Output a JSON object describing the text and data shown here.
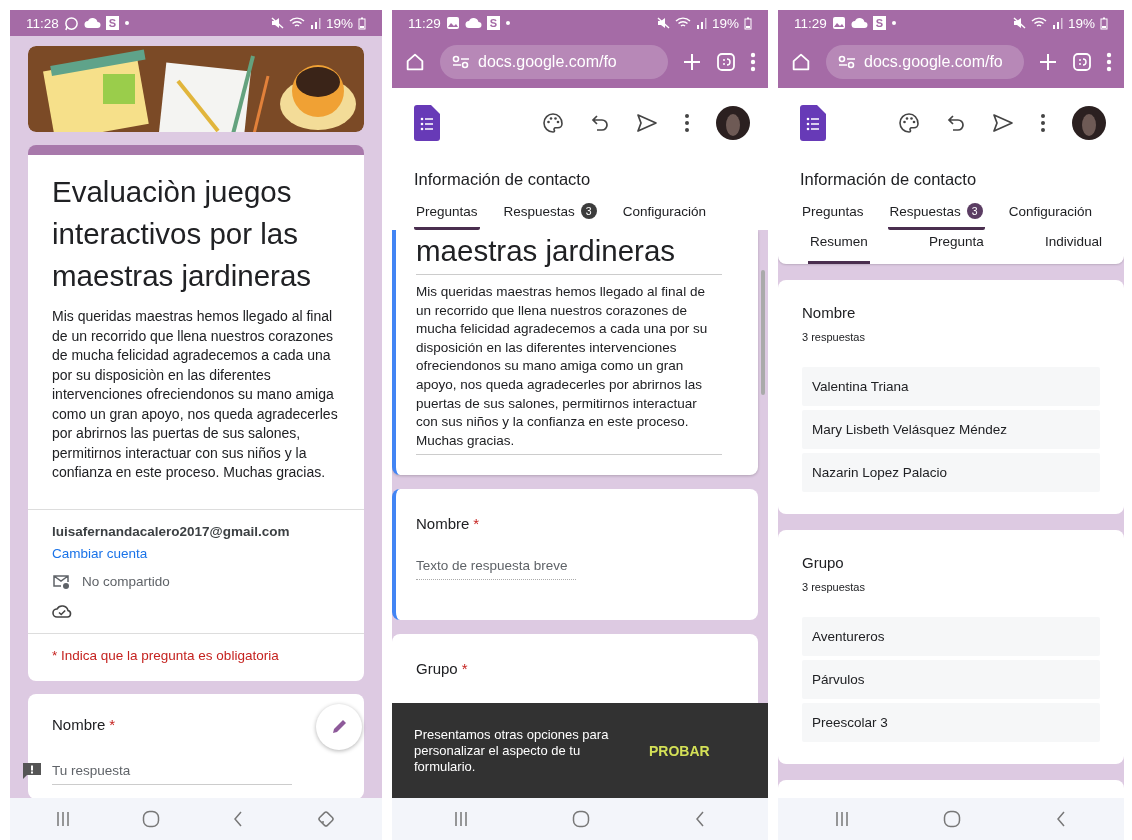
{
  "phones": [
    {
      "kind": "respond",
      "status_bar": {
        "time": "11:28",
        "icons": [
          {
            "kind": "chat"
          },
          {
            "kind": "cloud"
          }
        ],
        "app_badge": "S",
        "battery": "19%"
      },
      "form": {
        "title": "Evaluaciòn juegos interactivos por las maestras jardineras",
        "description": "Mis queridas maestras hemos llegado al final de un recorrido que llena nuestros corazones de mucha felicidad agradecemos a cada una por su disposiciòn en las diferentes intervenciones ofreciendonos su mano amiga como un gran apoyo, nos queda agradecerles por abrirnos las puertas de sus salones, permitirnos interactuar con sus niños y la confianza en este proceso. Muchas gracias.",
        "email": "luisafernandacalero2017@gmail.com",
        "switch_account": "Cambiar cuenta",
        "sharing": "No compartido",
        "required_note": "* Indica que la pregunta es obligatoria"
      },
      "questions": [
        {
          "label": "Nombre",
          "required_mark": "*",
          "placeholder": "Tu respuesta"
        }
      ],
      "nav_bar": {
        "rotate_button": true
      }
    },
    {
      "kind": "editor",
      "status_bar": {
        "time": "11:29",
        "icons": [
          {
            "kind": "image"
          },
          {
            "kind": "cloud"
          }
        ],
        "app_badge": "S",
        "battery": "19%"
      },
      "browser": {
        "url": "docs.google.com/fo"
      },
      "app": {
        "title": "Información de contacto",
        "tabs": [
          {
            "label": "Preguntas",
            "selected": true
          },
          {
            "label": "Respuestas",
            "badge": "3",
            "selected": false
          },
          {
            "label": "Configuración",
            "selected": false
          }
        ]
      },
      "form": {
        "title": "maestras jardineras",
        "description": "Mis queridas maestras hemos llegado al final de un recorrido que llena nuestros corazones de mucha felicidad agradecemos a cada una por su disposición en las diferentes intervenciones ofreciendonos su mano amiga como un gran apoyo, nos queda agradecerles por abrirnos las puertas de sus salones, permitirnos interactuar con sus niños y la confianza en este proceso. Muchas gracias.",
        "active": true
      },
      "questions": [
        {
          "label": "Nombre",
          "required_mark": "*",
          "placeholder": "Texto de respuesta breve",
          "active": true
        },
        {
          "label": "Grupo",
          "required_mark": "*",
          "active": false
        }
      ],
      "snackbar": {
        "message": "Presentamos otras opciones para personalizar el aspecto de tu formulario.",
        "action": "PROBAR"
      },
      "nav_bar": {
        "rotate_button": false
      }
    },
    {
      "kind": "summary",
      "status_bar": {
        "time": "11:29",
        "icons": [
          {
            "kind": "image"
          },
          {
            "kind": "cloud"
          }
        ],
        "app_badge": "S",
        "battery": "19%"
      },
      "browser": {
        "url": "docs.google.com/fo"
      },
      "app": {
        "title": "Información de contacto",
        "tabs": [
          {
            "label": "Preguntas",
            "selected": false
          },
          {
            "label": "Respuestas",
            "badge": "3",
            "selected": true
          },
          {
            "label": "Configuración",
            "selected": false
          }
        ]
      },
      "subtabs": [
        {
          "label": "Resumen",
          "selected": true
        },
        {
          "label": "Pregunta",
          "selected": false
        },
        {
          "label": "Individual",
          "selected": false
        }
      ],
      "summaries": [
        {
          "question": "Nombre",
          "count": "3 respuestas",
          "answers": [
            "Valentina Triana",
            "Mary Lisbeth Velásquez Méndez",
            "Nazarin Lopez Palacio"
          ]
        },
        {
          "question": "Grupo",
          "count": "3 respuestas",
          "answers": [
            "Aventureros",
            "Párvulos",
            "Preescolar 3"
          ]
        }
      ],
      "nav_bar": {
        "rotate_button": false
      }
    }
  ]
}
